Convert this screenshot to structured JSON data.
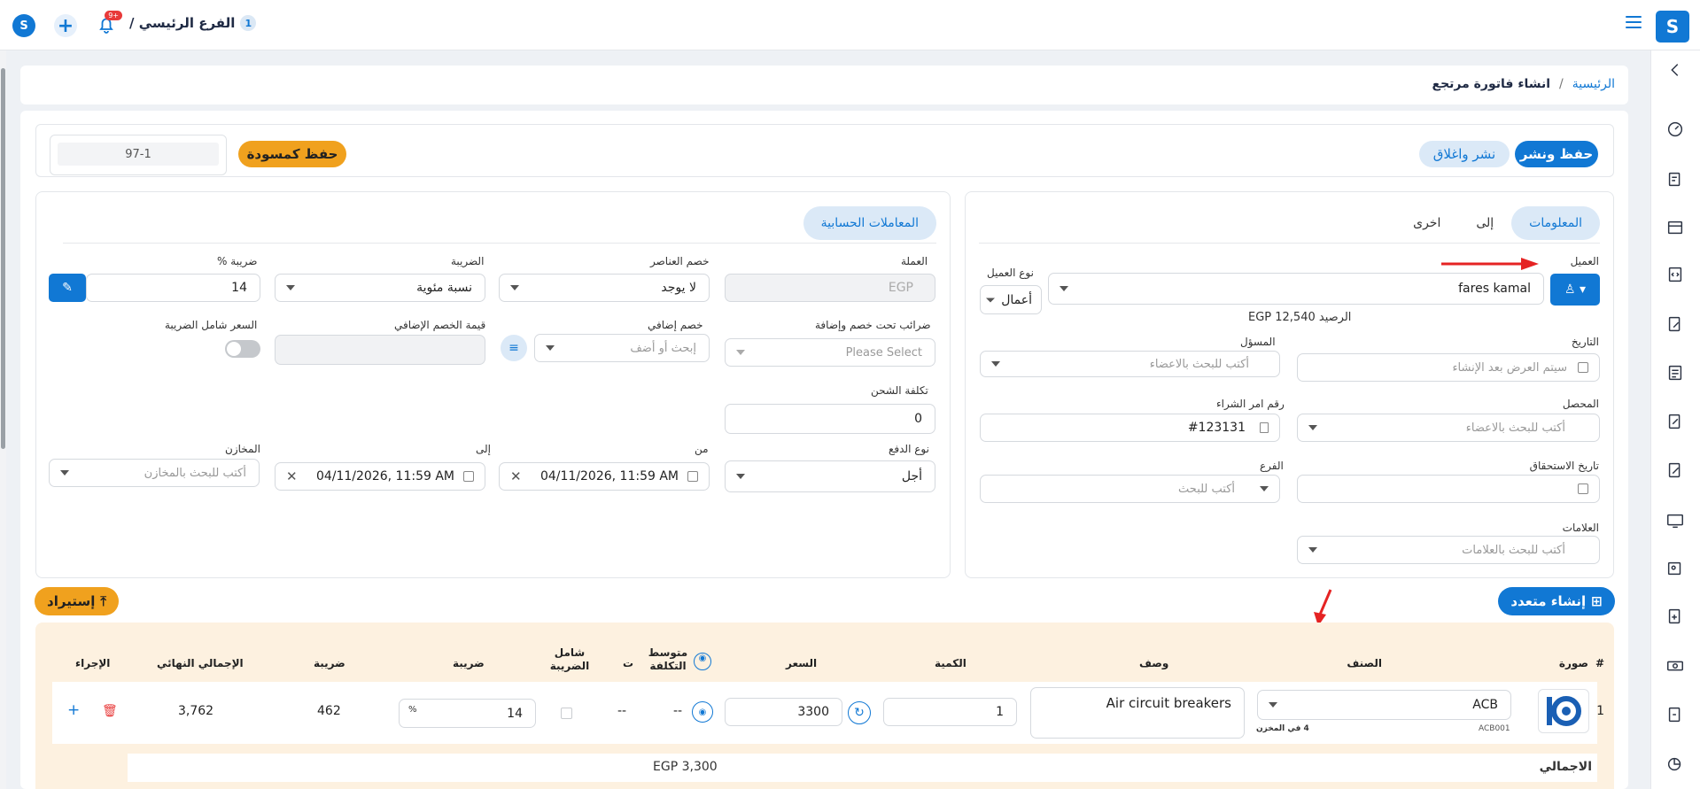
{
  "topbar": {
    "branch_number": "1",
    "branch_name": "الفرع الرئيسي /",
    "notifications_badge": "+9"
  },
  "breadcrumb": {
    "home": "الرئيسية",
    "separator": "/",
    "current": "انشاء فاتورة مرتجع"
  },
  "header": {
    "publish_label": "حفظ ونشر",
    "publish_close_label": "نشر واغلاق",
    "draft_label": "حفظ كمسودة",
    "invoice_code": "97-1"
  },
  "tabs": {
    "info": "المعلومات",
    "to": "إلى",
    "other": "اخرى",
    "accounting": "المعاملات الحسابية"
  },
  "customer": {
    "label": "العميل",
    "value": "fares kamal",
    "balance": "الرصيد EGP 12,540",
    "type_label": "نوع العميل",
    "type_value": "أعمال"
  },
  "fields": {
    "date_label": "التاريخ",
    "date_placeholder": "سيتم العرض بعد الإنشاء",
    "responsible_label": "المسؤل",
    "responsible_placeholder": "أكتب للبحث بالاعضاء",
    "collector_label": "المحصل",
    "collector_placeholder": "أكتب للبحث بالاعضاء",
    "po_label": "رقم امر الشراء",
    "po_value": "#123131",
    "due_label": "تاريخ الاستحقاق",
    "branch_label": "الفرع",
    "branch_placeholder": "أكتب للبحث",
    "tags_label": "العلامات",
    "tags_placeholder": "أكتب للبحث بالعلامات"
  },
  "accounting": {
    "currency_label": "العملة",
    "currency_value": "EGP",
    "discount_label": "خصم العناصر",
    "discount_value": "لا يوجد",
    "tax_label": "الضريبة",
    "tax_value": "نسبة مئوية",
    "tax_pct_label": "ضريبة %",
    "tax_pct_value": "14",
    "taxes_discount_label": "ضرائب تحت خصم وإضافة",
    "taxes_discount_placeholder": "Please Select",
    "extra_discount_label": "خصم إضافي",
    "extra_discount_placeholder": "إبحث أو أضف",
    "extra_discount_value_label": "قيمة الخصم الإضافي",
    "price_incl_tax_label": "السعر شامل الضريبة",
    "shipping_label": "تكلفة الشحن",
    "shipping_value": "0",
    "payment_label": "نوع الدفع",
    "payment_value": "أجل",
    "from_label": "من",
    "from_value": "04/11/2026, 11:59 AM",
    "to_label": "إلى",
    "to_value": "04/11/2026, 11:59 AM",
    "warehouses_label": "المخازن",
    "warehouses_placeholder": "أكتب للبحث بالمخازن"
  },
  "items": {
    "import_label": "إستيراد",
    "multi_label": "إنشاء متعدد",
    "headers": {
      "num": "#",
      "image": "صورة",
      "item": "الصنف",
      "desc": "وصف",
      "qty": "الكمية",
      "price": "السعر",
      "avg_cost": "متوسط التكلفة",
      "t": "ت",
      "incl_tax": "شامل الضريبة",
      "tax": "ضريبة",
      "tax_amount": "ضريبة",
      "final_total": "الإجمالي النهائي",
      "action": "الإجراء"
    },
    "row": {
      "num": "1",
      "item_value": "ACB",
      "item_code": "ACB001",
      "stock": "4 في المخزن",
      "desc": "Air circuit breakers",
      "qty": "1",
      "price": "3300",
      "avg_cost": "--",
      "t": "--",
      "tax_pct": "14",
      "pct_sign": "%",
      "tax_amount": "462",
      "final_total": "3,762"
    },
    "total_label": "الاجمالي",
    "total_value": "EGP 3,300"
  }
}
